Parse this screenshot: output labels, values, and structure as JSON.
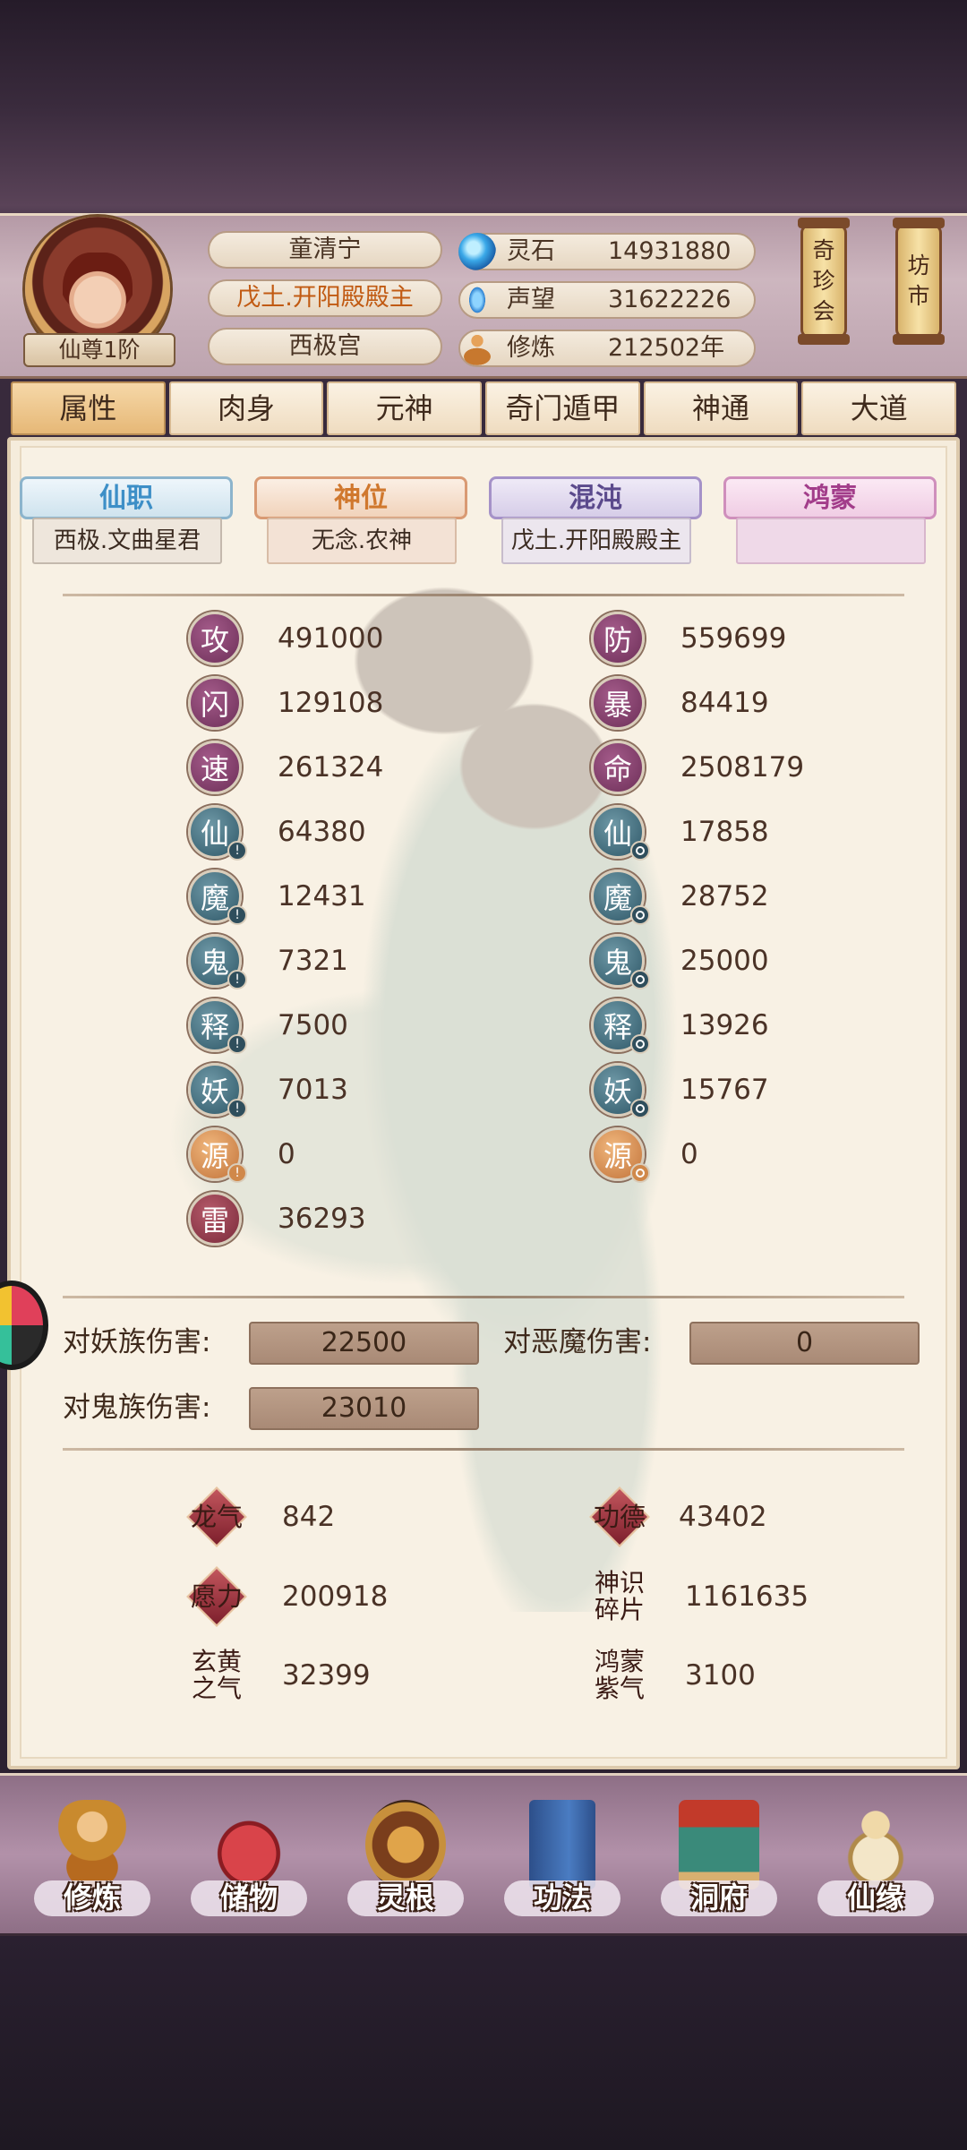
{
  "player": {
    "rank": "仙尊1阶",
    "name": "童清宁",
    "title": "戊土.开阳殿殿主",
    "sect": "西极宫"
  },
  "resources": {
    "lingshi": {
      "label": "灵石",
      "value": "14931880",
      "icon": "spirit-stone-icon",
      "color": "#3aa8e8"
    },
    "shengwang": {
      "label": "声望",
      "value": "31622226",
      "icon": "reputation-icon",
      "color": "#2b7fd0"
    },
    "xiulian": {
      "label": "修炼",
      "value": "212502年",
      "icon": "meditation-icon",
      "color": "#c7782e"
    }
  },
  "lanterns": {
    "qizhenhui": [
      "奇",
      "珍",
      "会"
    ],
    "fangshi": [
      "坊",
      "市"
    ]
  },
  "tabs": [
    "属性",
    "肉身",
    "元神",
    "奇门遁甲",
    "神通",
    "大道"
  ],
  "active_tab": "属性",
  "ranks": {
    "xianzhi": {
      "title": "仙职",
      "value": "西极.文曲星君"
    },
    "shenwei": {
      "title": "神位",
      "value": "无念.农神"
    },
    "hundun": {
      "title": "混沌",
      "value": "戊土.开阳殿殿主"
    },
    "hongmeng": {
      "title": "鸿蒙",
      "value": ""
    }
  },
  "stats_left": [
    {
      "icon": "攻",
      "value": "491000"
    },
    {
      "icon": "闪",
      "value": "129108"
    },
    {
      "icon": "速",
      "value": "261324"
    },
    {
      "icon": "仙",
      "value": "64380"
    },
    {
      "icon": "魔",
      "value": "12431"
    },
    {
      "icon": "鬼",
      "value": "7321"
    },
    {
      "icon": "释",
      "value": "7500"
    },
    {
      "icon": "妖",
      "value": "7013"
    },
    {
      "icon": "源",
      "value": "0"
    },
    {
      "icon": "雷",
      "value": "36293"
    }
  ],
  "stats_right": [
    {
      "icon": "防",
      "value": "559699"
    },
    {
      "icon": "暴",
      "value": "84419"
    },
    {
      "icon": "命",
      "value": "2508179"
    },
    {
      "icon": "仙",
      "value": "17858"
    },
    {
      "icon": "魔",
      "value": "28752"
    },
    {
      "icon": "鬼",
      "value": "25000"
    },
    {
      "icon": "释",
      "value": "13926"
    },
    {
      "icon": "妖",
      "value": "15767"
    },
    {
      "icon": "源",
      "value": "0"
    }
  ],
  "damage": {
    "yaozu": {
      "label": "对妖族伤害:",
      "value": "22500"
    },
    "emo": {
      "label": "对恶魔伤害:",
      "value": "0"
    },
    "guizu": {
      "label": "对鬼族伤害:",
      "value": "23010"
    }
  },
  "extra": {
    "longqi": {
      "label": "龙气",
      "value": "842"
    },
    "gongde": {
      "label": "功德",
      "value": "43402"
    },
    "yuanli": {
      "label": "愿力",
      "value": "200918"
    },
    "shenshi": {
      "label": "神识碎片",
      "value": "1161635"
    },
    "xuanhuang": {
      "label": "玄黄之气",
      "value": "32399"
    },
    "hongmengziqi": {
      "label": "鸿蒙紫气",
      "value": "3100"
    }
  },
  "nav": [
    "修炼",
    "储物",
    "灵根",
    "功法",
    "洞府",
    "仙缘"
  ]
}
